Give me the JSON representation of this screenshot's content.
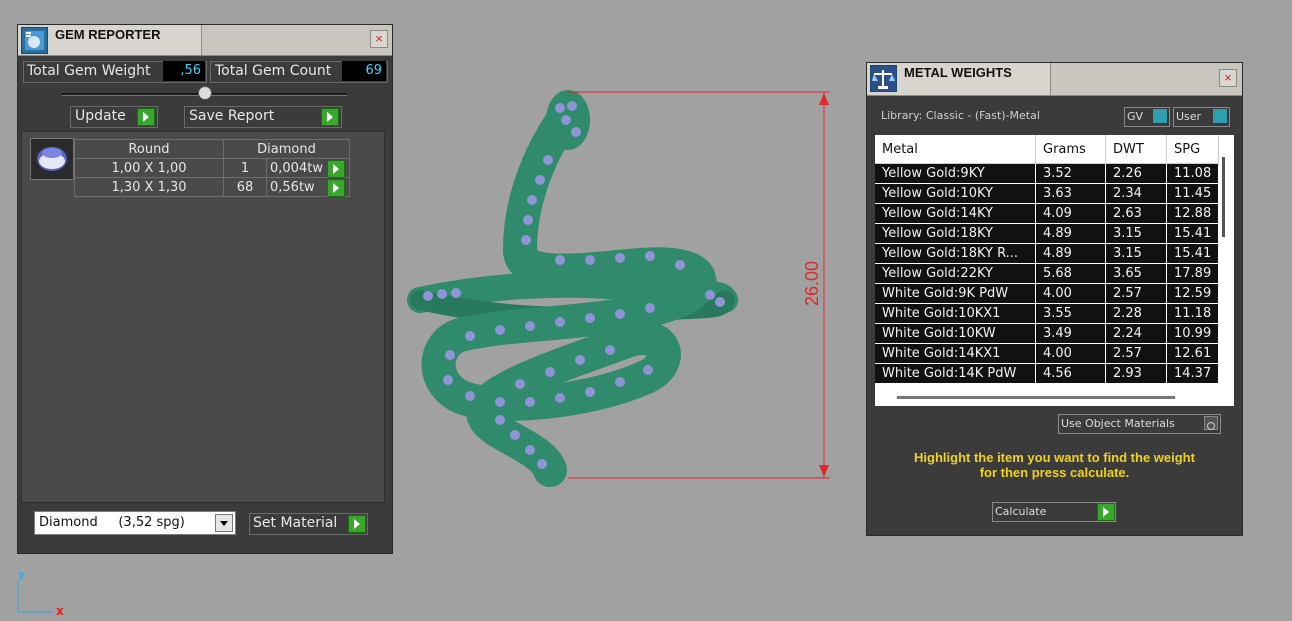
{
  "gem_reporter": {
    "title": "GEM REPORTER",
    "total_weight_label": "Total Gem Weight",
    "total_weight_value": ",56",
    "total_count_label": "Total Gem Count",
    "total_count_value": "69",
    "update_label": "Update",
    "save_report_label": "Save Report",
    "headers": [
      "Round",
      "Diamond"
    ],
    "rows": [
      {
        "size": "1,00 X 1,00",
        "count": "1",
        "weight": "0,004tw"
      },
      {
        "size": "1,30 X 1,30",
        "count": "68",
        "weight": "0,56tw"
      }
    ],
    "material_select": "Diamond     (3,52 spg)",
    "set_material_label": "Set Material",
    "close_symbol": "×"
  },
  "viewport": {
    "dimension_text": "26.00",
    "axis_y": "y",
    "axis_x": "x",
    "colors": {
      "ring": "#2f8b6c",
      "stones": "#8e94d6",
      "dimension": "#e0282a"
    }
  },
  "metal_weights": {
    "title": "METAL WEIGHTS",
    "library_label": "Library: Classic - (Fast)-Metal",
    "gv_label": "GV",
    "user_label": "User",
    "columns": [
      "Metal",
      "Grams",
      "DWT",
      "SPG"
    ],
    "rows": [
      [
        "Yellow Gold:9KY",
        "3.52",
        "2.26",
        "11.08"
      ],
      [
        "Yellow Gold:10KY",
        "3.63",
        "2.34",
        "11.45"
      ],
      [
        "Yellow Gold:14KY",
        "4.09",
        "2.63",
        "12.88"
      ],
      [
        "Yellow Gold:18KY",
        "4.89",
        "3.15",
        "15.41"
      ],
      [
        "Yellow Gold:18KY R...",
        "4.89",
        "3.15",
        "15.41"
      ],
      [
        "Yellow Gold:22KY",
        "5.68",
        "3.65",
        "17.89"
      ],
      [
        "White Gold:9K PdW",
        "4.00",
        "2.57",
        "12.59"
      ],
      [
        "White Gold:10KX1",
        "3.55",
        "2.28",
        "11.18"
      ],
      [
        "White Gold:10KW",
        "3.49",
        "2.24",
        "10.99"
      ],
      [
        "White Gold:14KX1",
        "4.00",
        "2.57",
        "12.61"
      ],
      [
        "White Gold:14K PdW",
        "4.56",
        "2.93",
        "14.37"
      ]
    ],
    "use_object_materials_label": "Use Object Materials",
    "hint_line1": "Highlight the item you want to find the weight",
    "hint_line2": "for then press calculate.",
    "calculate_label": "Calculate",
    "close_symbol": "×"
  }
}
